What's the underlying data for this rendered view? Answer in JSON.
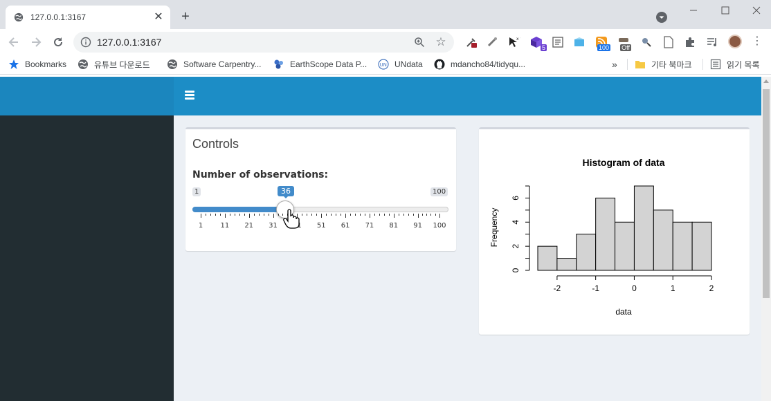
{
  "browser": {
    "tab_title": "127.0.0.1:3167",
    "url": "127.0.0.1:3167",
    "new_tab_symbol": "+",
    "close_symbol": "✕",
    "extension_badges": {
      "ext4": "5",
      "ext9": "100",
      "ext10": "Off"
    }
  },
  "bookmarks": {
    "items": [
      {
        "label": "Bookmarks",
        "icon": "star-icon"
      },
      {
        "label": "유튜브 다운로드",
        "icon": "globe-icon"
      },
      {
        "label": "Software Carpentry...",
        "icon": "globe-icon"
      },
      {
        "label": "EarthScope Data P...",
        "icon": "earthscope-icon"
      },
      {
        "label": "UNdata",
        "icon": "undata-icon"
      },
      {
        "label": "mdancho84/tidyqu...",
        "icon": "github-icon"
      }
    ],
    "overflow": "»",
    "other_folder": "기타 북마크",
    "reading_list": "읽기 목록"
  },
  "app": {
    "controls": {
      "title": "Controls",
      "label": "Number of observations:",
      "slider": {
        "min": 1,
        "max": 100,
        "value": 36,
        "min_label": "1",
        "max_label": "100",
        "value_label": "36",
        "ticks": [
          "1",
          "11",
          "21",
          "31",
          "41",
          "51",
          "61",
          "71",
          "81",
          "91",
          "100"
        ]
      }
    }
  },
  "chart_data": {
    "type": "bar",
    "title": "Histogram of data",
    "xlabel": "data",
    "ylabel": "Frequency",
    "bins": [
      -2.5,
      -2.0,
      -1.5,
      -1.0,
      -0.5,
      0.0,
      0.5,
      1.0,
      1.5,
      2.0
    ],
    "values": [
      2,
      1,
      3,
      6,
      4,
      7,
      5,
      4,
      4
    ],
    "x_ticks": [
      "-2",
      "-1",
      "0",
      "1",
      "2"
    ],
    "y_ticks": [
      "0",
      "2",
      "4",
      "6"
    ],
    "xlim": [
      -2.5,
      2.0
    ],
    "ylim": [
      0,
      7
    ],
    "bar_color": "#d3d3d3",
    "grid": false
  },
  "colors": {
    "header_blue": "#1c8dc6",
    "sidebar_dark": "#222d32",
    "slider_blue": "#428bca",
    "content_bg": "#ecf0f5"
  }
}
